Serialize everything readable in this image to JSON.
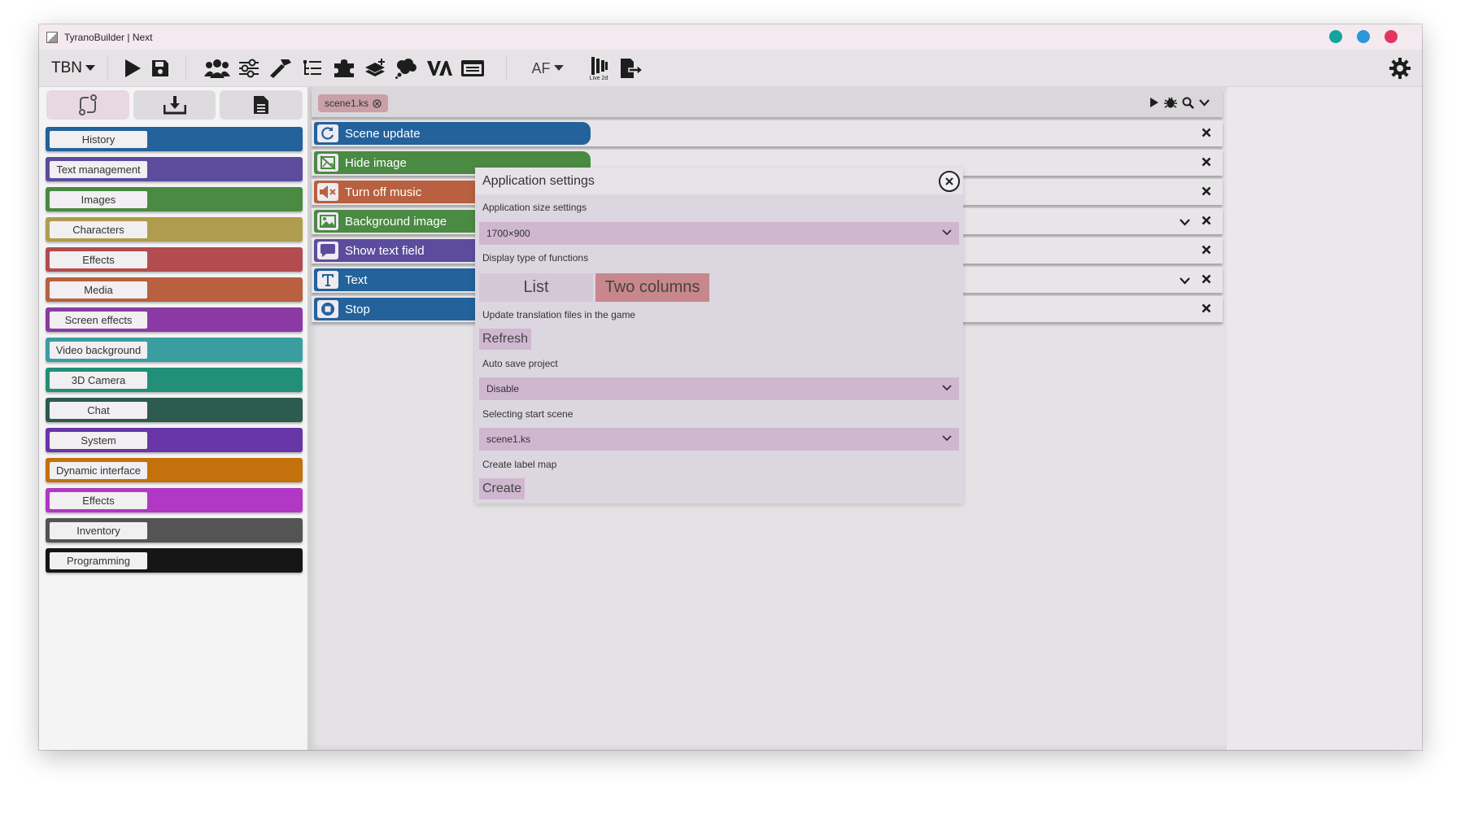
{
  "window": {
    "title": "TyranoBuilder | Next"
  },
  "toolbar": {
    "project_menu": "TBN",
    "af_menu": "AF",
    "live2d_label": "Live 2d"
  },
  "sidebar": {
    "categories": [
      {
        "label": "History",
        "color": "#23629b"
      },
      {
        "label": "Text management",
        "color": "#5b4c9d"
      },
      {
        "label": "Images",
        "color": "#4a8a43"
      },
      {
        "label": "Characters",
        "color": "#b09c4e"
      },
      {
        "label": "Effects",
        "color": "#b24c4f"
      },
      {
        "label": "Media",
        "color": "#b8603f"
      },
      {
        "label": "Screen effects",
        "color": "#8b3aa5"
      },
      {
        "label": "Video background",
        "color": "#3a9ea1"
      },
      {
        "label": "3D Camera",
        "color": "#229078"
      },
      {
        "label": "Chat",
        "color": "#2d5b4d"
      },
      {
        "label": "System",
        "color": "#6936a8"
      },
      {
        "label": "Dynamic interface",
        "color": "#c4700c"
      },
      {
        "label": "Effects",
        "color": "#b137c5"
      },
      {
        "label": "Inventory",
        "color": "#545454"
      },
      {
        "label": "Programming",
        "color": "#161616"
      }
    ]
  },
  "editor": {
    "file_tab": "scene1.ks",
    "blocks": [
      {
        "label": "Scene update",
        "color": "#23629b",
        "icon": "refresh-icon"
      },
      {
        "label": "Hide image",
        "color": "#4a8a43",
        "icon": "hide-image-icon"
      },
      {
        "label": "Turn off music",
        "color": "#b8603f",
        "icon": "mute-icon"
      },
      {
        "label": "Background image",
        "color": "#4a8a43",
        "icon": "image-icon"
      },
      {
        "label": "Show text field",
        "color": "#5b4c9d",
        "icon": "speech-bubble-icon"
      },
      {
        "label": "Text",
        "color": "#23629b",
        "icon": "text-icon"
      },
      {
        "label": "Stop",
        "color": "#23629b",
        "icon": "stop-icon"
      }
    ]
  },
  "dialog": {
    "title": "Application settings",
    "app_size_label": "Application size settings",
    "app_size_value": "1700×900",
    "display_type_label": "Display type of functions",
    "display_option_list": "List",
    "display_option_two": "Two columns",
    "translation_label": "Update translation files in the game",
    "refresh_button": "Refresh",
    "autosave_label": "Auto save project",
    "autosave_value": "Disable",
    "start_scene_label": "Selecting start scene",
    "start_scene_value": "scene1.ks",
    "label_map_label": "Create label map",
    "create_button": "Create"
  }
}
